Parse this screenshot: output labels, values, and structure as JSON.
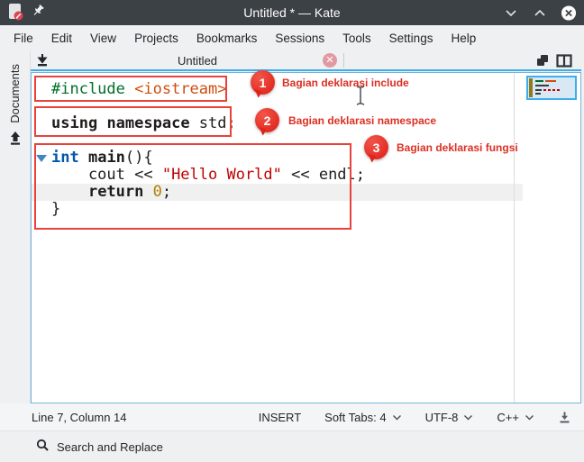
{
  "titlebar": {
    "title": "Untitled * — Kate"
  },
  "menubar": {
    "items": [
      "File",
      "Edit",
      "View",
      "Projects",
      "Bookmarks",
      "Sessions",
      "Tools",
      "Settings",
      "Help"
    ]
  },
  "sidebar": {
    "documents_label": "Documents"
  },
  "tabbar": {
    "tab_label": "Untitled",
    "close_glyph": "✕"
  },
  "editor": {
    "lines": [
      [
        {
          "t": "#include",
          "c": "preproc"
        },
        {
          "t": " ",
          "c": "plain"
        },
        {
          "t": "<iostream>",
          "c": "inc"
        }
      ],
      [],
      [
        {
          "t": "using",
          "c": "kw"
        },
        {
          "t": " ",
          "c": "plain"
        },
        {
          "t": "namespace",
          "c": "kw"
        },
        {
          "t": " std;",
          "c": "plain"
        }
      ],
      [],
      [
        {
          "t": "int",
          "c": "type"
        },
        {
          "t": " ",
          "c": "plain"
        },
        {
          "t": "main",
          "c": "fn"
        },
        {
          "t": "(){",
          "c": "plain"
        }
      ],
      [
        {
          "t": "    cout << ",
          "c": "plain"
        },
        {
          "t": "\"Hello World\"",
          "c": "str"
        },
        {
          "t": " << endl;",
          "c": "plain"
        }
      ],
      [
        {
          "t": "    ",
          "c": "plain"
        },
        {
          "t": "return",
          "c": "kw"
        },
        {
          "t": " ",
          "c": "plain"
        },
        {
          "t": "0",
          "c": "num"
        },
        {
          "t": ";",
          "c": "plain"
        }
      ],
      [
        {
          "t": "}",
          "c": "plain"
        }
      ]
    ],
    "current_line_number": 7,
    "annotations": [
      {
        "number": "1",
        "label": "Bagian deklarasi include"
      },
      {
        "number": "2",
        "label": "Bagian deklarasi namespace"
      },
      {
        "number": "3",
        "label": "Bagian deklarasi fungsi"
      }
    ]
  },
  "statusbar": {
    "cursor_position": "Line 7, Column 14",
    "mode": "INSERT",
    "tab_mode": "Soft Tabs: 4",
    "encoding": "UTF-8",
    "language": "C++"
  },
  "searchbar": {
    "label": "Search and Replace"
  },
  "colors": {
    "accent": "#3daee9",
    "annotation_red": "#e23c30",
    "string_red": "#bf0303",
    "preprocessor_green": "#006e28",
    "include_orange": "#cf4e0d",
    "type_blue": "#0057ae",
    "number_gold": "#b08000"
  }
}
